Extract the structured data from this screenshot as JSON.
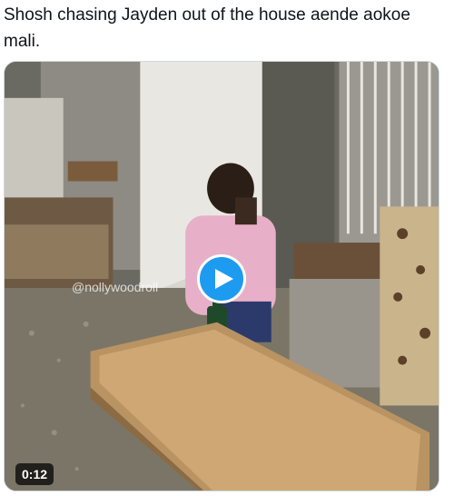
{
  "tweet": {
    "text": "Shosh chasing Jayden out of the house aende aokoe mali."
  },
  "video": {
    "watermark": "@nollywoodroll",
    "duration": "0:12",
    "play_icon": "play-icon",
    "accent_color": "#1d9bf0"
  }
}
